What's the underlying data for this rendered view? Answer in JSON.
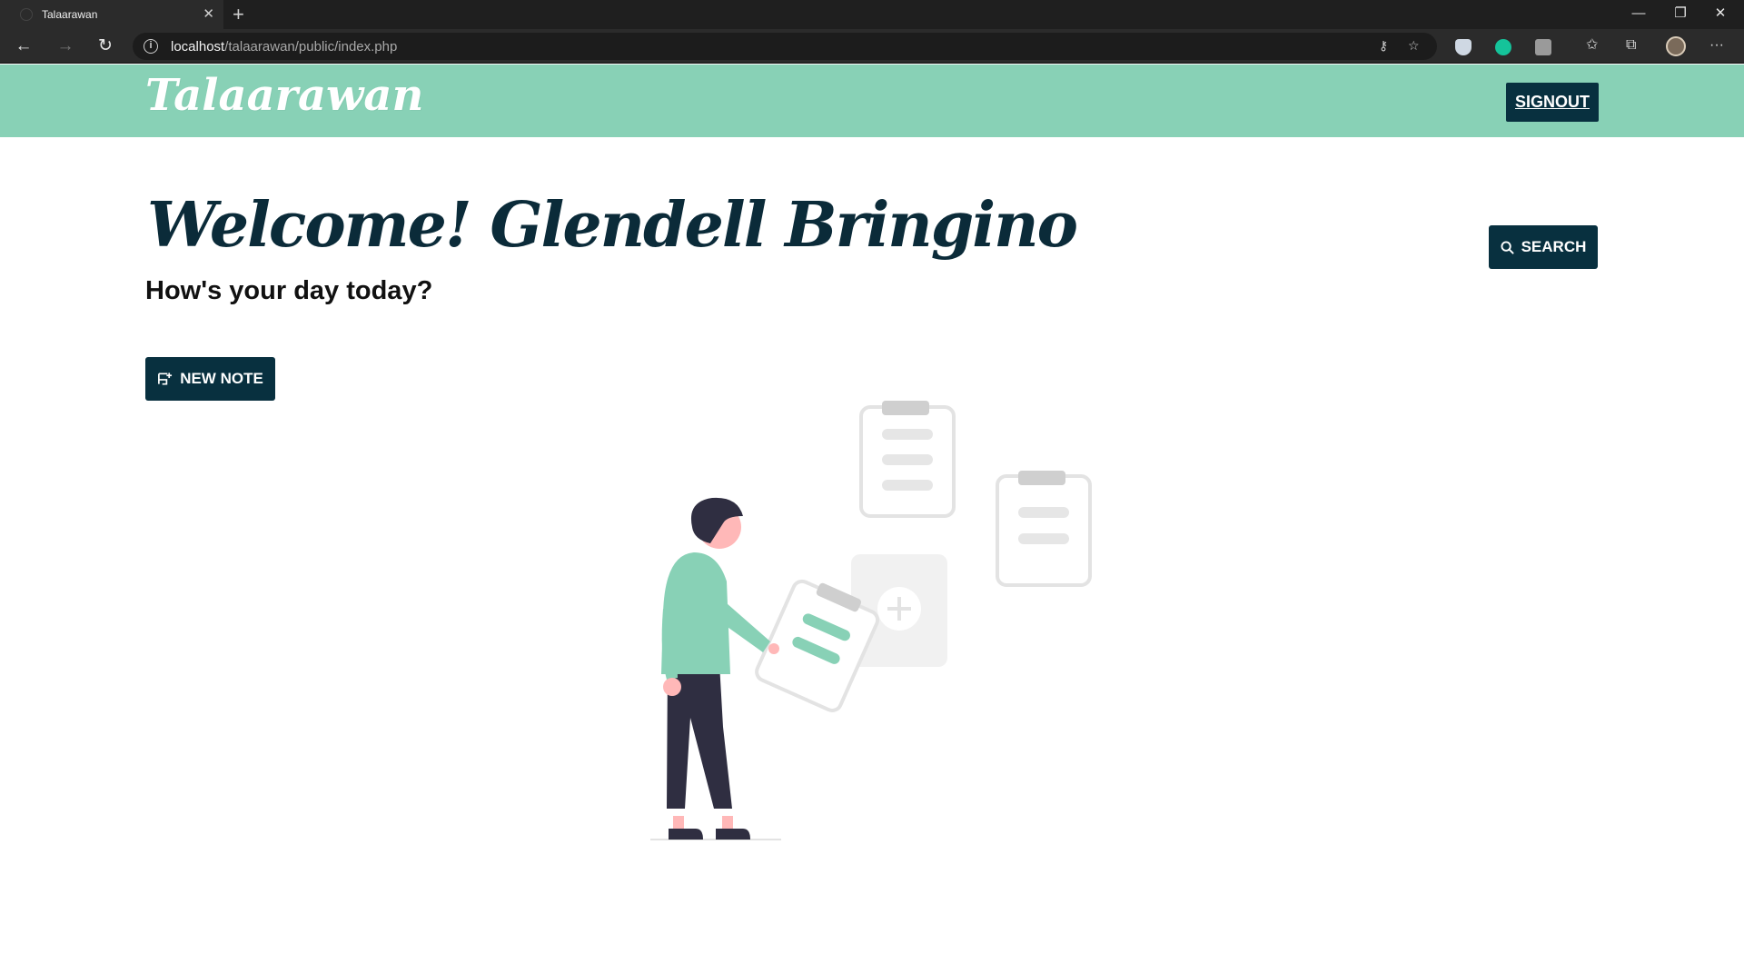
{
  "browser": {
    "tab_title": "Talaarawan",
    "new_tab_symbol": "+",
    "url_host": "localhost",
    "url_path": "/talaarawan/public/index.php"
  },
  "header": {
    "logo": "Talaarawan",
    "signout_label": "SIGNOUT"
  },
  "main": {
    "welcome": "Welcome! Glendell Bringino",
    "subtitle": "How's your day today?",
    "search_label": "SEARCH",
    "new_note_label": "NEW NOTE"
  },
  "colors": {
    "header_bg": "#88d1b6",
    "dark_button": "#08303f",
    "welcome_text": "#0b2b39"
  }
}
